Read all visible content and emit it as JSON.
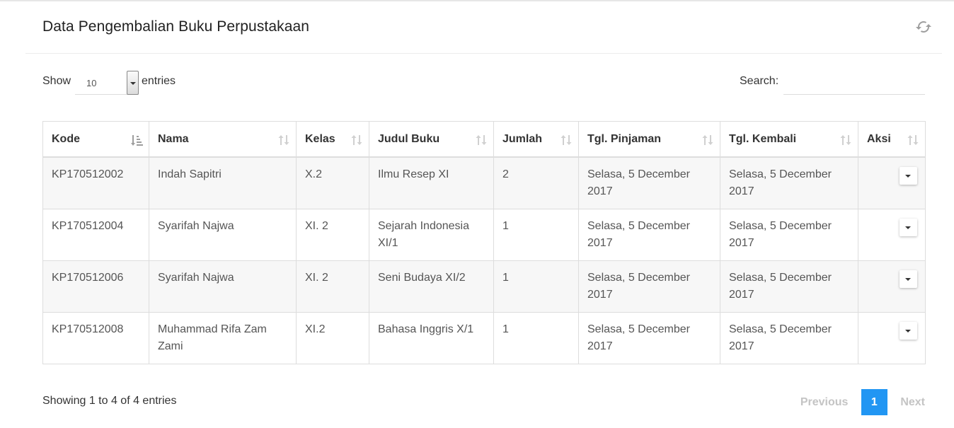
{
  "header": {
    "title": "Data Pengembalian Buku Perpustakaan",
    "refresh_icon": "refresh-icon"
  },
  "controls": {
    "show_label": "Show",
    "length_value": "10",
    "entries_label": "entries",
    "search_label": "Search:",
    "search_value": ""
  },
  "table": {
    "columns": [
      {
        "label": "Kode",
        "sort": "ascending"
      },
      {
        "label": "Nama",
        "sort": "none"
      },
      {
        "label": "Kelas",
        "sort": "none"
      },
      {
        "label": "Judul Buku",
        "sort": "none"
      },
      {
        "label": "Jumlah",
        "sort": "none"
      },
      {
        "label": "Tgl. Pinjaman",
        "sort": "none"
      },
      {
        "label": "Tgl. Kembali",
        "sort": "none"
      },
      {
        "label": "Aksi",
        "sort": "none"
      }
    ],
    "rows": [
      {
        "kode": "KP170512002",
        "nama": "Indah Sapitri",
        "kelas": "X.2",
        "judul": "Ilmu Resep XI",
        "jumlah": "2",
        "tgl_pinjam": "Selasa, 5 December 2017",
        "tgl_kembali": "Selasa, 5 December 2017"
      },
      {
        "kode": "KP170512004",
        "nama": "Syarifah Najwa",
        "kelas": "XI. 2",
        "judul": "Sejarah Indonesia XI/1",
        "jumlah": "1",
        "tgl_pinjam": "Selasa, 5 December 2017",
        "tgl_kembali": "Selasa, 5 December 2017"
      },
      {
        "kode": "KP170512006",
        "nama": "Syarifah Najwa",
        "kelas": "XI. 2",
        "judul": "Seni Budaya XI/2",
        "jumlah": "1",
        "tgl_pinjam": "Selasa, 5 December 2017",
        "tgl_kembali": "Selasa, 5 December 2017"
      },
      {
        "kode": "KP170512008",
        "nama": "Muhammad Rifa Zam Zami",
        "kelas": "XI.2",
        "judul": "Bahasa Inggris X/1",
        "jumlah": "1",
        "tgl_pinjam": "Selasa, 5 December 2017",
        "tgl_kembali": "Selasa, 5 December 2017"
      }
    ]
  },
  "footer": {
    "info": "Showing 1 to 4 of 4 entries",
    "previous": "Previous",
    "page": "1",
    "next": "Next"
  },
  "colors": {
    "accent": "#2196f3",
    "stripe": "#f7f7f7",
    "border": "#dddddd",
    "disabled": "#c4c4c4"
  }
}
